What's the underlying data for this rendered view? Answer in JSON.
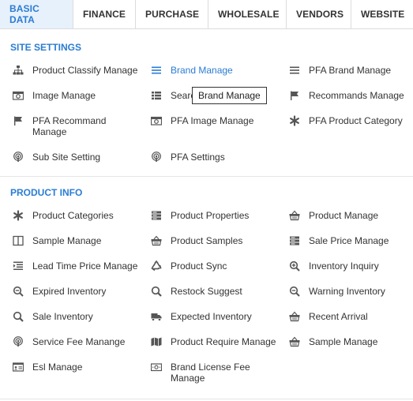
{
  "tabs": [
    "BASIC DATA",
    "FINANCE",
    "PURCHASE",
    "WHOLESALE",
    "VENDORS",
    "WEBSITE"
  ],
  "sections": {
    "site_settings": {
      "title": "SITE SETTINGS",
      "items": [
        {
          "label": "Product Classify Manage",
          "icon": "sitemap-icon"
        },
        {
          "label": "Brand Manage",
          "icon": "list-icon",
          "active": true
        },
        {
          "label": "PFA Brand Manage",
          "icon": "list-icon"
        },
        {
          "label": "Image Manage",
          "icon": "camera-icon"
        },
        {
          "label": "Search Manage",
          "visible_label": "Searc",
          "icon": "list-bullet-icon"
        },
        {
          "label": "Recommands Manage",
          "icon": "flag-icon"
        },
        {
          "label": "PFA Recommand Manage",
          "icon": "flag-icon"
        },
        {
          "label": "PFA Image Manage",
          "icon": "camera-icon"
        },
        {
          "label": "PFA Product Category",
          "icon": "asterisk-icon"
        },
        {
          "label": "Sub Site Setting",
          "icon": "podcast-icon"
        },
        {
          "label": "PFA Settings",
          "icon": "podcast-icon"
        }
      ]
    },
    "product_info": {
      "title": "PRODUCT INFO",
      "items": [
        {
          "label": "Product Categories",
          "icon": "asterisk-icon"
        },
        {
          "label": "Product Properties",
          "icon": "server-icon"
        },
        {
          "label": "Product Manage",
          "icon": "basket-icon"
        },
        {
          "label": "Sample Manage",
          "icon": "columns-icon"
        },
        {
          "label": "Product Samples",
          "icon": "basket-icon"
        },
        {
          "label": "Sale Price Manage",
          "icon": "server-icon"
        },
        {
          "label": "Lead Time Price Manage",
          "icon": "indent-icon"
        },
        {
          "label": "Product Sync",
          "icon": "recycle-icon"
        },
        {
          "label": "Inventory Inquiry",
          "icon": "search-plus-icon"
        },
        {
          "label": "Expired Inventory",
          "icon": "search-minus-icon"
        },
        {
          "label": "Restock Suggest",
          "icon": "search-icon"
        },
        {
          "label": "Warning Inventory",
          "icon": "search-minus-icon"
        },
        {
          "label": "Sale Inventory",
          "icon": "search-icon"
        },
        {
          "label": "Expected Inventory",
          "icon": "truck-icon"
        },
        {
          "label": "Recent Arrival",
          "icon": "basket-icon"
        },
        {
          "label": "Service Fee Manange",
          "icon": "podcast-icon"
        },
        {
          "label": "Product Require Manage",
          "icon": "map-icon"
        },
        {
          "label": "Sample Manage",
          "icon": "basket-icon"
        },
        {
          "label": "Esl Manage",
          "icon": "id-card-icon"
        },
        {
          "label": "Brand License Fee Manage",
          "icon": "money-bill-icon"
        }
      ]
    }
  },
  "tooltip": "Brand Manage",
  "colors": {
    "accent": "#2b7cd3",
    "active_tab_bg": "#e7f1fb",
    "text": "#333333"
  }
}
